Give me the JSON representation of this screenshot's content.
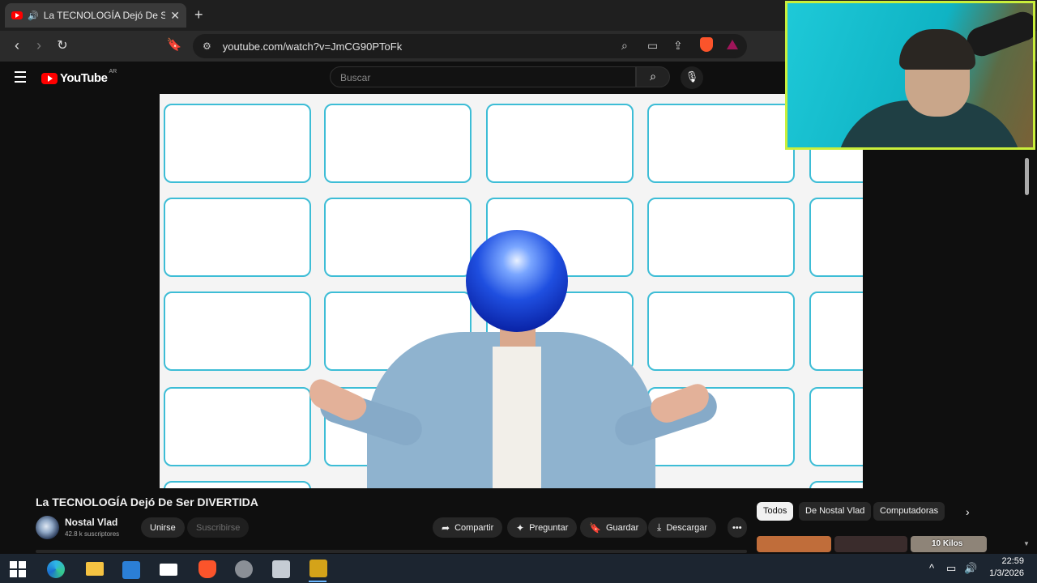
{
  "browser": {
    "tab_title": "La TECNOLOGÍA Dejó De Ser DIVERTIDA",
    "url": "youtube.com/watch?v=JmCG90PToFk",
    "new_tab": "+",
    "tab_close": "✕"
  },
  "youtube": {
    "logo_text": "YouTube",
    "country_code": "AR",
    "search_placeholder": "Buscar"
  },
  "video": {
    "title": "La TECNOLOGÍA Dejó De Ser DIVERTIDA",
    "channel_name": "Nostal Vlad",
    "subscribers": "42.8 k suscriptores",
    "join_label": "Unirse",
    "subscribe_label": "Suscribirse",
    "actions": [
      {
        "label": "Compartir",
        "icon": "share-icon"
      },
      {
        "label": "Preguntar",
        "icon": "sparkle-icon"
      },
      {
        "label": "Guardar",
        "icon": "bookmark-icon"
      },
      {
        "label": "Descargar",
        "icon": "download-icon"
      }
    ]
  },
  "chips": [
    "Todos",
    "De Nostal Vlad",
    "Computadoras"
  ],
  "recommendation_thumb_text": "10 Kilos",
  "taskbar": {
    "time": "22:59",
    "date": "1/3/2026"
  }
}
